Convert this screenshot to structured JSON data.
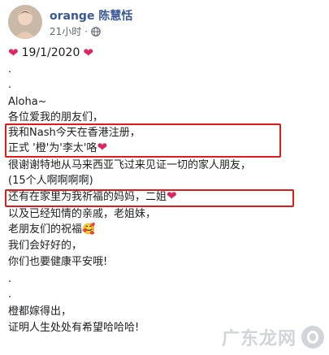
{
  "post_header": {
    "author": "orange 陈慧恬",
    "time": "21小时",
    "dot": "·",
    "privacy_icon": "globe-icon"
  },
  "post": {
    "date_line": "19/1/2020",
    "lines": [
      ".",
      ".",
      "Aloha~",
      "各位爱我的朋友们，",
      "我和Nash今天在香港注册，",
      "正式 '橙'为'李太'咯",
      "很谢谢特地从马来西亚飞过来见证一切的家人朋友，",
      "(15个人啊啊啊啊)",
      "还有在家里为我祈福的妈妈，二姐",
      "以及已经知情的亲戚，老姐妹，",
      "老朋友们的祝福",
      "我们会好好的，",
      "你们也要健康平安哦!",
      ".",
      ".",
      "橙都嫁得出，",
      "证明人生处处有希望哈哈哈!"
    ],
    "emoji": {
      "heart": "❤",
      "smiling_hearts": "🥰"
    }
  },
  "watermark": {
    "text": "广东龙网"
  },
  "colors": {
    "author_blue": "#385898",
    "highlight_red": "#e01b1b",
    "heart_red": "#e0245e"
  }
}
